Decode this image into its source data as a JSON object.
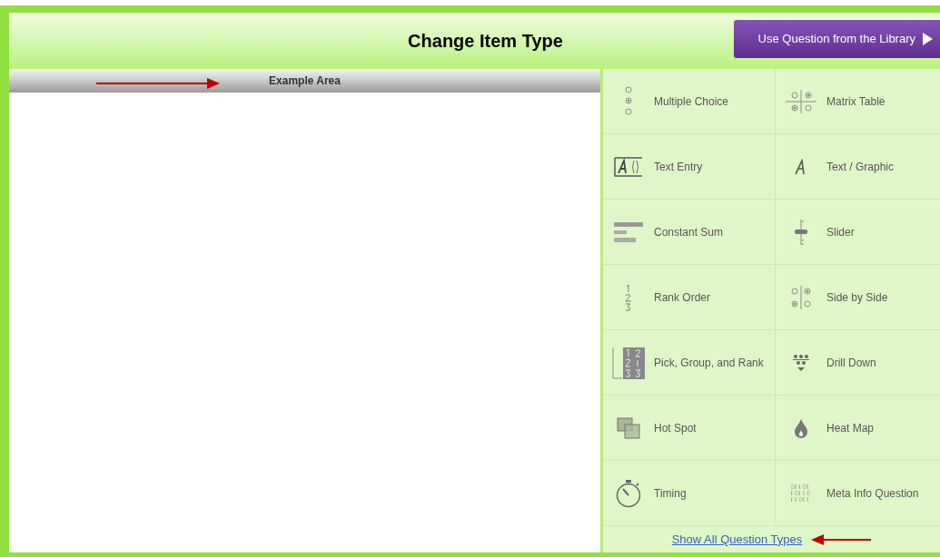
{
  "header": {
    "title": "Change Item Type",
    "library_button": "Use Question from the Library"
  },
  "example_area": {
    "title": "Example Area"
  },
  "question_types": [
    {
      "label": "Multiple Choice"
    },
    {
      "label": "Matrix Table"
    },
    {
      "label": "Text Entry"
    },
    {
      "label": "Text / Graphic"
    },
    {
      "label": "Constant Sum"
    },
    {
      "label": "Slider"
    },
    {
      "label": "Rank Order"
    },
    {
      "label": "Side by Side"
    },
    {
      "label": "Pick, Group, and Rank"
    },
    {
      "label": "Drill Down"
    },
    {
      "label": "Hot Spot"
    },
    {
      "label": "Heat Map"
    },
    {
      "label": "Timing"
    },
    {
      "label": "Meta Info Question"
    }
  ],
  "show_all_link": "Show All Question Types"
}
